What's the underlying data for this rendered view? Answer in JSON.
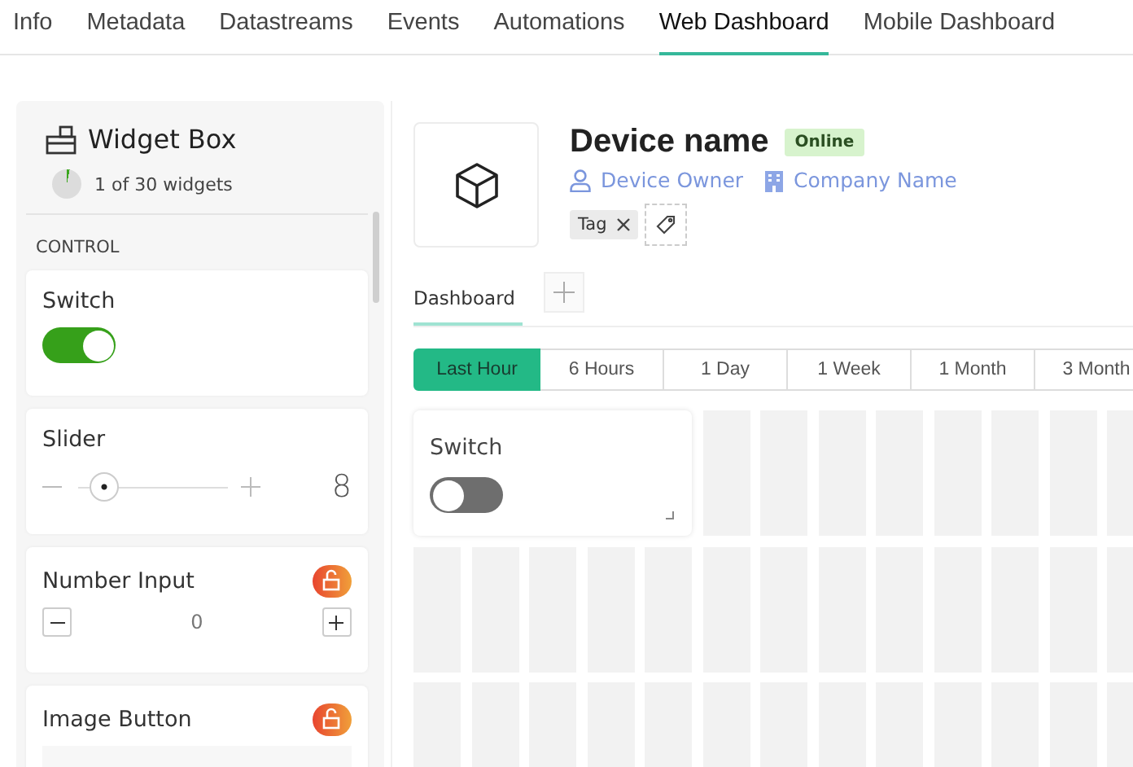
{
  "tabs": [
    {
      "label": "Info",
      "selected": false
    },
    {
      "label": "Metadata",
      "selected": false
    },
    {
      "label": "Datastreams",
      "selected": false
    },
    {
      "label": "Events",
      "selected": false
    },
    {
      "label": "Automations",
      "selected": false
    },
    {
      "label": "Web Dashboard",
      "selected": true
    },
    {
      "label": "Mobile Dashboard",
      "selected": false
    }
  ],
  "sidebar": {
    "title": "Widget Box",
    "usage": {
      "text": "1 of 30 widgets",
      "level": 0.033
    },
    "section": "CONTROL",
    "widgets": [
      {
        "kind": "switch",
        "title": "Switch",
        "on": true,
        "locked": false
      },
      {
        "kind": "slider",
        "title": "Slider",
        "value": "8",
        "level": 0.1,
        "locked": false
      },
      {
        "kind": "number",
        "title": "Number Input",
        "value": "0",
        "locked": true
      },
      {
        "kind": "image",
        "title": "Image Button",
        "locked": true
      }
    ]
  },
  "device": {
    "name": "Device name",
    "status": "Online",
    "owner": "Device Owner",
    "company": "Company Name",
    "tags": [
      {
        "label": "Tag"
      }
    ]
  },
  "dashboard_tabs": [
    {
      "label": "Dashboard",
      "selected": true
    }
  ],
  "time_ranges": [
    {
      "label": "Last Hour",
      "selected": true
    },
    {
      "label": "6 Hours",
      "selected": false
    },
    {
      "label": "1 Day",
      "selected": false
    },
    {
      "label": "1 Week",
      "selected": false
    },
    {
      "label": "1 Month",
      "selected": false
    },
    {
      "label": "3 Month",
      "selected": false
    }
  ],
  "canvas_widgets": [
    {
      "title": "Switch",
      "on": false
    }
  ]
}
